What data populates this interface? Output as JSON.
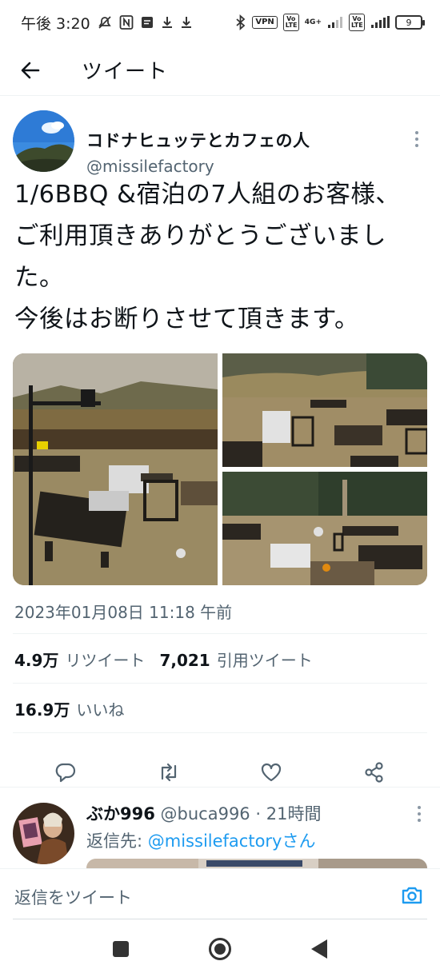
{
  "status_bar": {
    "time": "午後 3:20",
    "vpn": "VPN",
    "volte1": "Vo LTE",
    "network": "4G+",
    "volte2": "Vo LTE",
    "battery": "9"
  },
  "header": {
    "title": "ツイート"
  },
  "tweet": {
    "author_name": "コドナヒュッテとカフェの人",
    "author_handle": "@missilefactory",
    "text_lines": [
      "1/6BBQ &宿泊の7人組のお客様、",
      "ご利用頂きありがとうございまし",
      "た。",
      "今後はお断りさせて頂きます。"
    ],
    "timestamp": "2023年01月08日 11:18 午前",
    "retweets_count": "4.9万",
    "retweets_label": "リツイート",
    "quotes_count": "7,021",
    "quotes_label": "引用ツイート",
    "likes_count": "16.9万",
    "likes_label": "いいね"
  },
  "reply": {
    "name": "ぶか996",
    "handle": "@buca996",
    "separator": "·",
    "time": "21時間",
    "reply_to_prefix": "返信先: ",
    "reply_to_user": "@missilefactoryさん"
  },
  "compose": {
    "placeholder": "返信をツイート"
  },
  "colors": {
    "accent": "#1d9bf0",
    "text": "#0f1419",
    "secondary": "#536471"
  }
}
